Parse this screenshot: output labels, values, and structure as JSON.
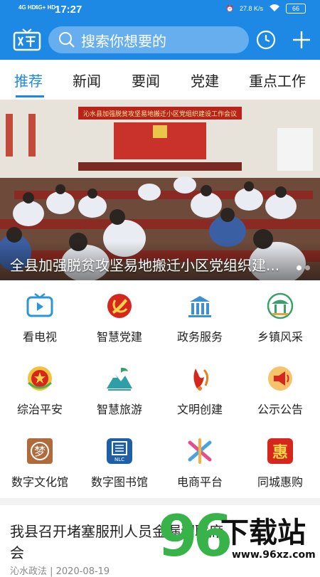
{
  "status_bar": {
    "signal1": "4G HD",
    "signal2": "4G+ HD",
    "time": "17:27",
    "net_speed": "27.8 K/s",
    "battery": "66"
  },
  "header": {
    "search_placeholder": "搜索你想要的",
    "logo_icon": "tv-logo-icon",
    "history_icon": "clock-icon",
    "add_icon": "plus-icon"
  },
  "tabs": [
    {
      "label": "推荐",
      "active": true
    },
    {
      "label": "新闻"
    },
    {
      "label": "要闻"
    },
    {
      "label": "党建"
    },
    {
      "label": "重点工作"
    }
  ],
  "banner": {
    "caption": "全县加强脱贫攻坚易地搬迁小区党组织建...",
    "photo_banner_text": "沁水县加强脱贫攻坚易地搬迁小区党组织建设工作会议"
  },
  "services": [
    {
      "label": "看电视",
      "icon": "tv-icon"
    },
    {
      "label": "智慧党建",
      "icon": "party-emblem-icon"
    },
    {
      "label": "政务服务",
      "icon": "government-building-icon"
    },
    {
      "label": "乡镇风采",
      "icon": "pavilion-icon"
    },
    {
      "label": "综治平安",
      "icon": "national-emblem-icon"
    },
    {
      "label": "智慧旅游",
      "icon": "mountain-icon"
    },
    {
      "label": "文明创建",
      "icon": "civilization-icon"
    },
    {
      "label": "公示公告",
      "icon": "megaphone-icon"
    },
    {
      "label": "数字文化馆",
      "icon": "culture-hall-icon"
    },
    {
      "label": "数字图书馆",
      "icon": "library-icon"
    },
    {
      "label": "电商平台",
      "icon": "ecommerce-icon"
    },
    {
      "label": "同城惠购",
      "icon": "discount-shopping-icon"
    }
  ],
  "news": {
    "title": "我县召开堵塞服刑人员金漏洞联席会",
    "meta": "沁水政法    | 2020-08-19"
  },
  "watermark": {
    "number": "96",
    "text": "下载站",
    "url": "www.96xz.com"
  },
  "colors": {
    "brand": "#1e88e5",
    "party_red": "#d7261e",
    "watermark_green": "#37b34a"
  }
}
